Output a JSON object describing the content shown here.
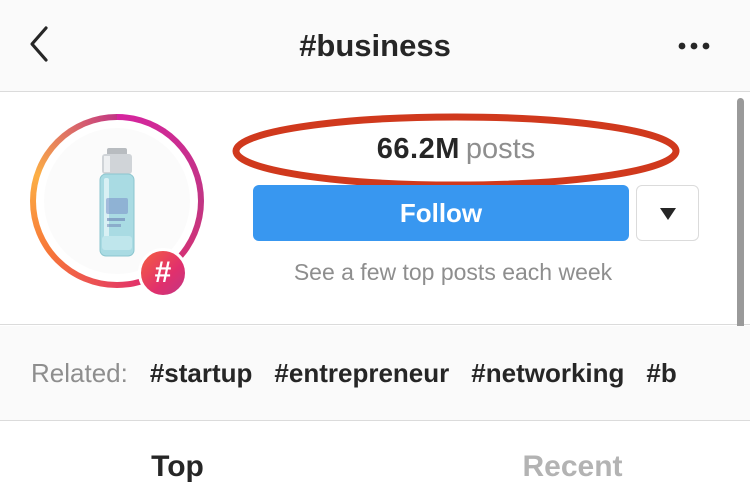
{
  "nav": {
    "title": "#business",
    "back_icon": "chevron-left-icon",
    "more_icon": "more-horizontal-icon"
  },
  "header": {
    "hashtag_badge": "#",
    "post_count": "66.2M",
    "post_label": "posts",
    "follow_label": "Follow",
    "dropdown_icon": "triangle-down-icon",
    "hint": "See a few top posts each week",
    "annotation_color": "#d0391d"
  },
  "related": {
    "label": "Related:",
    "tags": [
      "#startup",
      "#entrepreneur",
      "#networking",
      "#b"
    ]
  },
  "tabs": [
    {
      "label": "Top",
      "active": true
    },
    {
      "label": "Recent",
      "active": false
    }
  ],
  "colors": {
    "accent": "#3897f0",
    "text": "#262626",
    "muted": "#8e8e8e"
  }
}
